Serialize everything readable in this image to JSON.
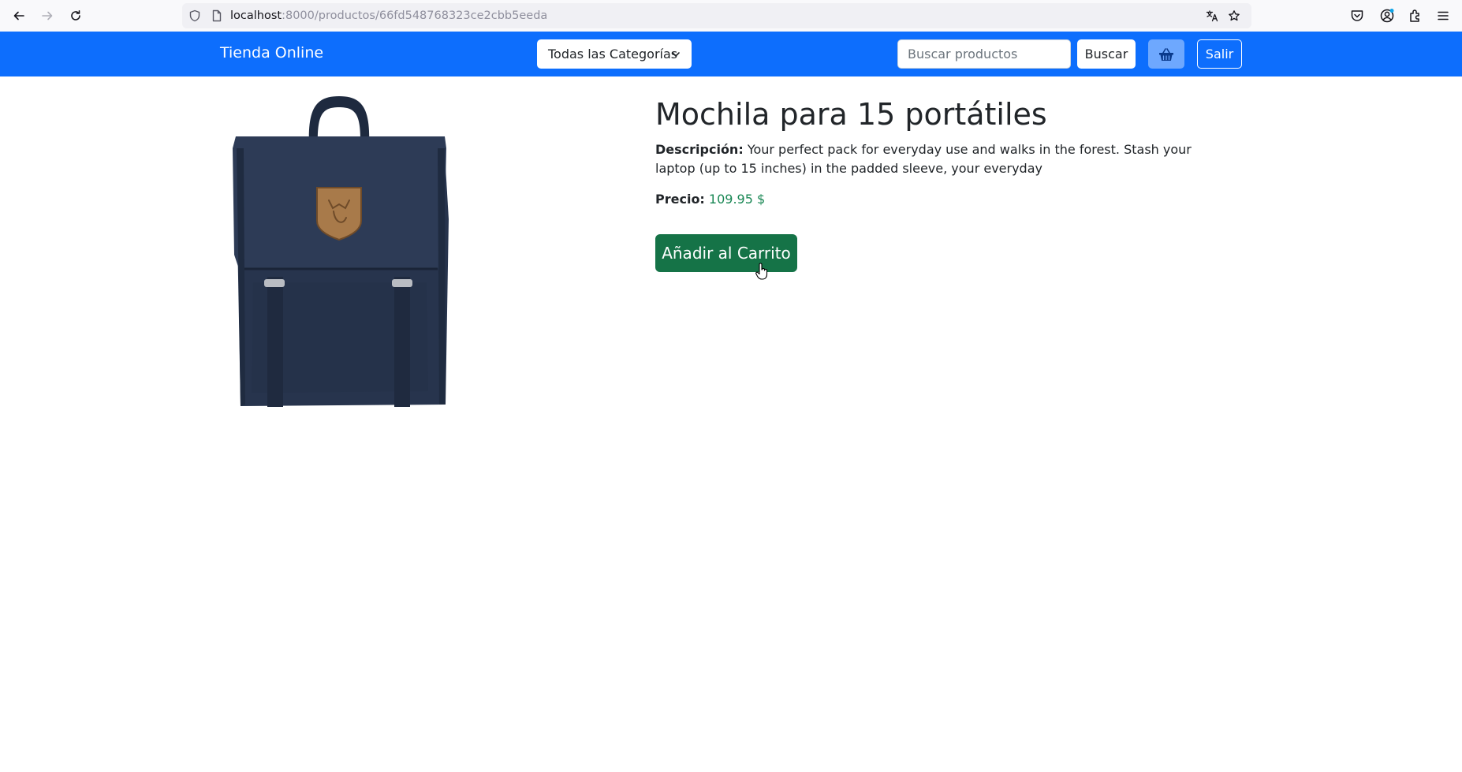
{
  "browser": {
    "url_host": "localhost",
    "url_path": ":8000/productos/66fd548768323ce2cbb5eeda",
    "icons": [
      "back-icon",
      "forward-icon",
      "reload-icon",
      "shield-icon",
      "page-icon",
      "translate-icon",
      "bookmark-star-icon",
      "pocket-icon",
      "account-icon",
      "extensions-icon",
      "menu-icon"
    ]
  },
  "navbar": {
    "brand": "Tienda Online",
    "category_select": "Todas las Categorías",
    "search_placeholder": "Buscar productos",
    "search_button": "Buscar",
    "cart_icon": "basket-icon",
    "logout_button": "Salir",
    "color": "#0d6efd"
  },
  "product": {
    "title": "Mochila para 15 portátiles",
    "description_label": "Descripción:",
    "description": "Your perfect pack for everyday use and walks in the forest. Stash your laptop (up to 15 inches) in the padded sleeve, your everyday",
    "price_label": "Precio:",
    "price": "109.95 $",
    "add_to_cart": "Añadir al Carrito",
    "price_color": "#198754",
    "button_color": "#157347"
  }
}
